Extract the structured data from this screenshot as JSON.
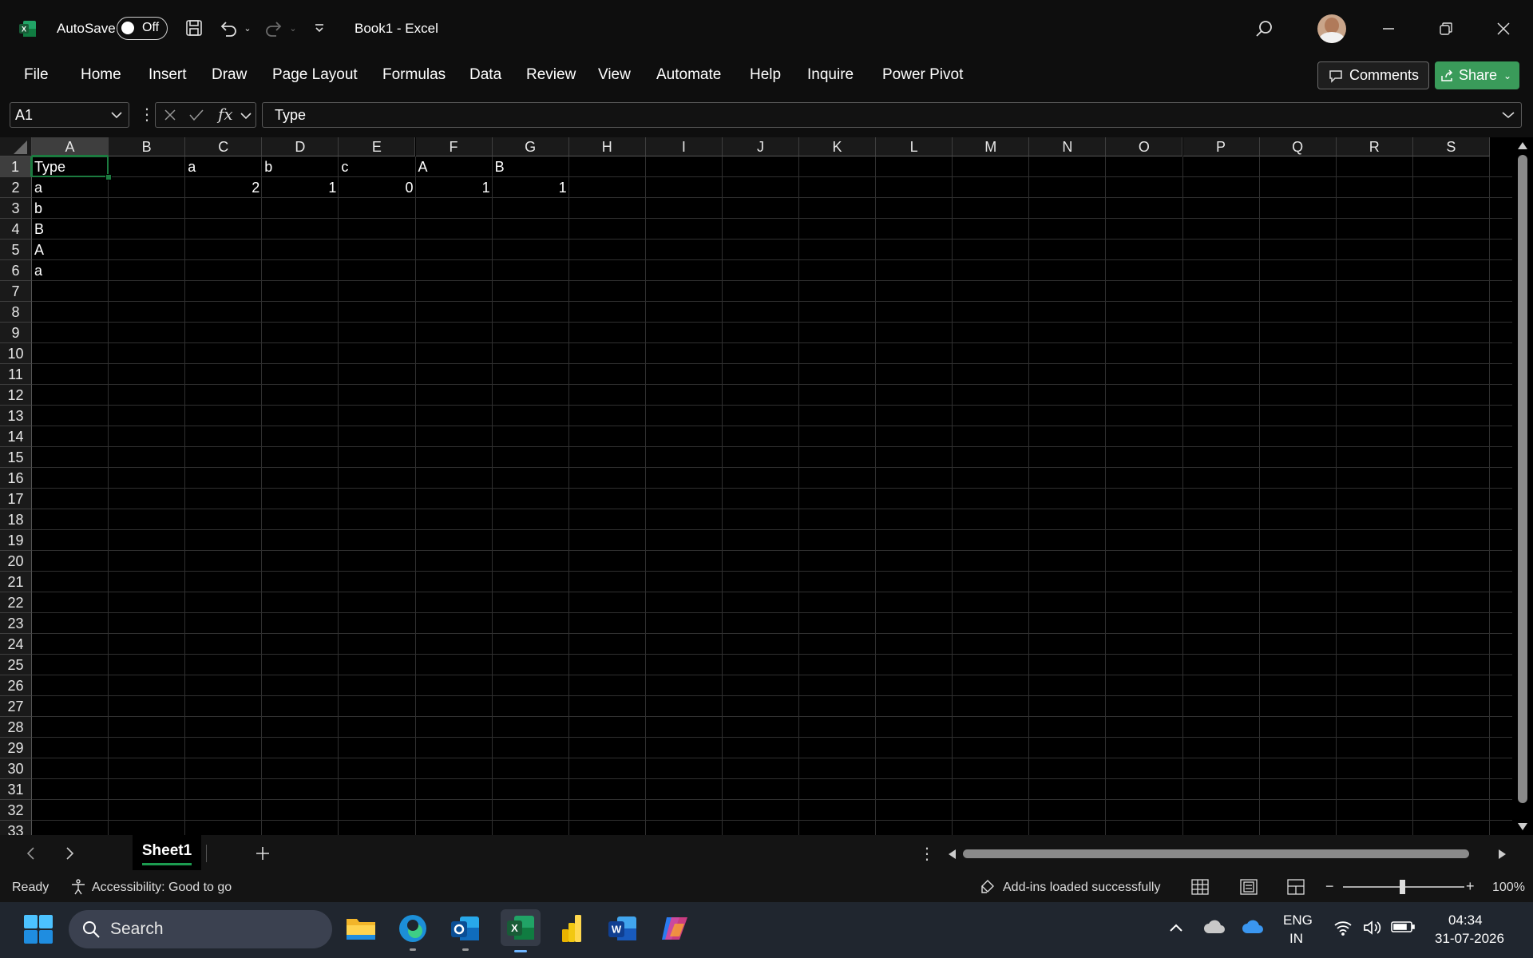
{
  "titlebar": {
    "autosave_label": "AutoSave",
    "autosave_state": "Off",
    "doc_title": "Book1  -  Excel"
  },
  "menu": [
    "File",
    "Home",
    "Insert",
    "Draw",
    "Page Layout",
    "Formulas",
    "Data",
    "Review",
    "View",
    "Automate",
    "Help",
    "Inquire",
    "Power Pivot"
  ],
  "actions": {
    "comments": "Comments",
    "share": "Share"
  },
  "formula_bar": {
    "name_box": "A1",
    "fx": "fx",
    "formula": "Type"
  },
  "grid": {
    "columns": [
      "A",
      "B",
      "C",
      "D",
      "E",
      "F",
      "G",
      "H",
      "I",
      "J",
      "K",
      "L",
      "M",
      "N",
      "O",
      "P",
      "Q",
      "R",
      "S"
    ],
    "rows": [
      "1",
      "2",
      "3",
      "4",
      "5",
      "6",
      "7",
      "8",
      "9",
      "10",
      "11",
      "12",
      "13",
      "14",
      "15",
      "16",
      "17",
      "18",
      "19",
      "20",
      "21",
      "22",
      "23",
      "24",
      "25",
      "26",
      "27",
      "28",
      "29",
      "30",
      "31",
      "32",
      "33"
    ],
    "active_cell": "A1",
    "cells": {
      "A1": "Type",
      "C1": "a",
      "D1": "b",
      "E1": "c",
      "F1": "A",
      "G1": "B",
      "A2": "a",
      "C2": "2",
      "D2": "1",
      "E2": "0",
      "F2": "1",
      "G2": "1",
      "A3": "b",
      "A4": "B",
      "A5": "A",
      "A6": "a"
    }
  },
  "sheets": {
    "tabs": [
      "Sheet1"
    ],
    "active": "Sheet1"
  },
  "status": {
    "ready": "Ready",
    "accessibility": "Accessibility: Good to go",
    "addins": "Add-ins loaded successfully",
    "zoom": "100%"
  },
  "taskbar": {
    "search_placeholder": "Search",
    "lang_top": "ENG",
    "lang_bottom": "IN",
    "time": "04:34",
    "date": "31-07-2026"
  },
  "colors": {
    "accent_green": "#1c7b40",
    "share_green": "#3a9b5a",
    "taskbar_bg": "#20262f"
  }
}
